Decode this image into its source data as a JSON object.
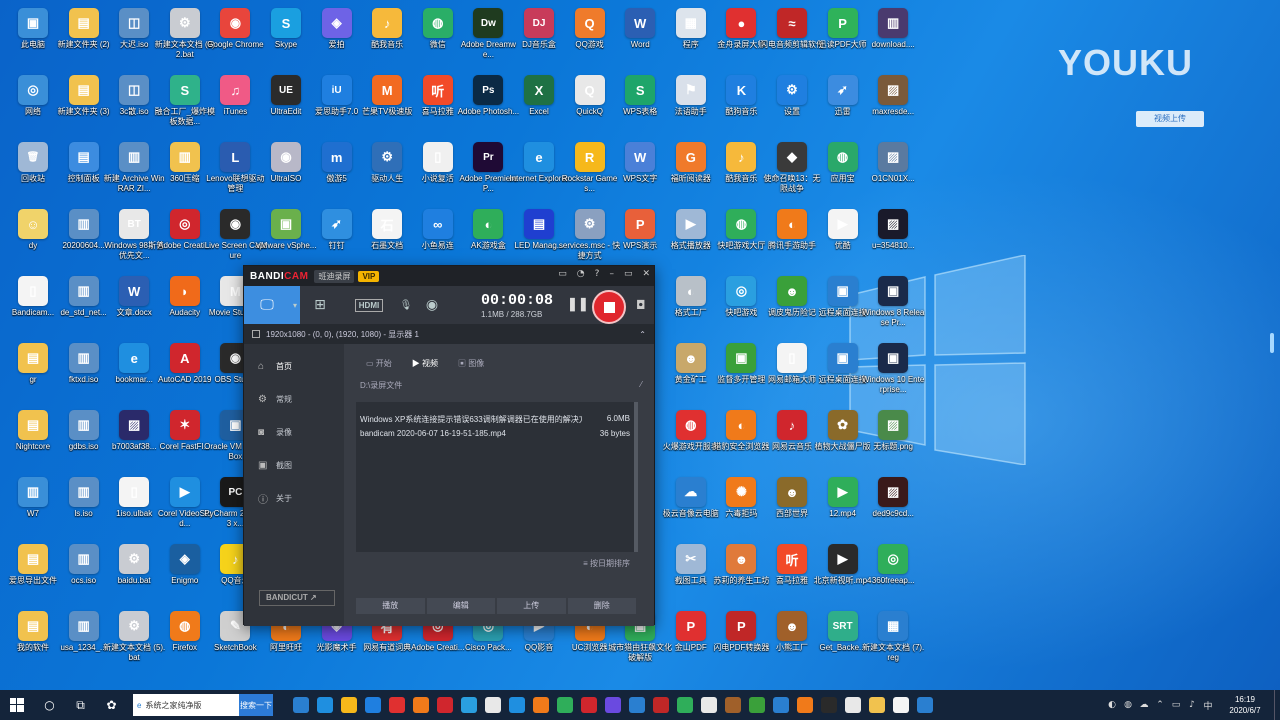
{
  "desktop": {
    "icons": [
      {
        "label": "此电脑",
        "color": "#3a8fd8",
        "glyph": "▣"
      },
      {
        "label": "新建文件夹 (2)",
        "color": "#f1c24e",
        "glyph": "▤"
      },
      {
        "label": "大迟.iso",
        "color": "#5a8fc6",
        "glyph": "◫"
      },
      {
        "label": "新建文本文档 (9)2.bat",
        "color": "#c9ccd2",
        "glyph": "⚙"
      },
      {
        "label": "Google Chrome",
        "color": "#e8453c",
        "glyph": "◉"
      },
      {
        "label": "Skype",
        "color": "#1a9fe0",
        "glyph": "S"
      },
      {
        "label": "爱拍",
        "color": "#6e63e6",
        "glyph": "◈"
      },
      {
        "label": "酷我音乐",
        "color": "#f6b93b",
        "glyph": "♪"
      },
      {
        "label": "微信",
        "color": "#2aae67",
        "glyph": "◍"
      },
      {
        "label": "Adobe Dreamwe...",
        "color": "#1f3b1f",
        "glyph": "Dw"
      },
      {
        "label": "DJ音乐盒",
        "color": "#c83b5a",
        "glyph": "DJ"
      },
      {
        "label": "QQ游戏",
        "color": "#ef7b2b",
        "glyph": "Q"
      },
      {
        "label": "Word",
        "color": "#2b5fb3",
        "glyph": "W"
      },
      {
        "label": "程序",
        "color": "#dde4ec",
        "glyph": "▦"
      },
      {
        "label": "金舟录屏大师",
        "color": "#e03030",
        "glyph": "●"
      },
      {
        "label": "闪电音频剪辑软件",
        "color": "#c02727",
        "glyph": "≈"
      },
      {
        "label": "迅读PDF大师",
        "color": "#2fb25a",
        "glyph": "P"
      },
      {
        "label": "download....",
        "color": "#4a3a6e",
        "glyph": "▥"
      },
      {
        "label": "网络",
        "color": "#3a8fd8",
        "glyph": "◎"
      },
      {
        "label": "新建文件夹 (3)",
        "color": "#f1c24e",
        "glyph": "▤"
      },
      {
        "label": "3c散.iso",
        "color": "#5a8fc6",
        "glyph": "◫"
      },
      {
        "label": "融合工厂_爆炸模板数据...",
        "color": "#2fb28a",
        "glyph": "S"
      },
      {
        "label": "iTunes",
        "color": "#f05a86",
        "glyph": "♫"
      },
      {
        "label": "UltraEdit",
        "color": "#2b2b2b",
        "glyph": "UE"
      },
      {
        "label": "爱思助手7.0",
        "color": "#1f7fe0",
        "glyph": "iU"
      },
      {
        "label": "芒果TV极速版",
        "color": "#f26a21",
        "glyph": "M"
      },
      {
        "label": "喜马拉雅",
        "color": "#f24a28",
        "glyph": "听"
      },
      {
        "label": "Adobe Photosh...",
        "color": "#0b2a45",
        "glyph": "Ps"
      },
      {
        "label": "Excel",
        "color": "#1f7144",
        "glyph": "X"
      },
      {
        "label": "QuickQ",
        "color": "#e8e8e8",
        "glyph": "Q"
      },
      {
        "label": "WPS表格",
        "color": "#1ea56a",
        "glyph": "S"
      },
      {
        "label": "法语助手",
        "color": "#d9e0ea",
        "glyph": "⚑"
      },
      {
        "label": "酷狗音乐",
        "color": "#1f7fe0",
        "glyph": "K"
      },
      {
        "label": "设置",
        "color": "#1f7fe0",
        "glyph": "⚙"
      },
      {
        "label": "迅雷",
        "color": "#3c8ce0",
        "glyph": "➶"
      },
      {
        "label": "maxresde...",
        "color": "#7a5a3a",
        "glyph": "▨"
      },
      {
        "label": "回收站",
        "color": "#9fb8d6",
        "glyph": "🗑"
      },
      {
        "label": "控制面板",
        "color": "#3c8ce0",
        "glyph": "▤"
      },
      {
        "label": "新建 Archive WinRAR ZI...",
        "color": "#5a8fc6",
        "glyph": "▥"
      },
      {
        "label": "360压缩",
        "color": "#f1c24e",
        "glyph": "▥"
      },
      {
        "label": "Lenovo联想驱动管理",
        "color": "#2a5cb0",
        "glyph": "L"
      },
      {
        "label": "UltraISO",
        "color": "#b8b8c8",
        "glyph": "◉"
      },
      {
        "label": "傲游5",
        "color": "#1f6fd0",
        "glyph": "m"
      },
      {
        "label": "驱动人生",
        "color": "#2f6fb8",
        "glyph": "⚙"
      },
      {
        "label": "小说复活",
        "color": "#f0f0f0",
        "glyph": "▯"
      },
      {
        "label": "Adobe Premiere P...",
        "color": "#1f0a35",
        "glyph": "Pr"
      },
      {
        "label": "Internet Explorer",
        "color": "#1f8fe0",
        "glyph": "e"
      },
      {
        "label": "Rockstar Games...",
        "color": "#f6b81b",
        "glyph": "R"
      },
      {
        "label": "WPS文字",
        "color": "#4a80d8",
        "glyph": "W"
      },
      {
        "label": "福昕阅读器",
        "color": "#f07a2a",
        "glyph": "G"
      },
      {
        "label": "酷我音乐",
        "color": "#f6b93b",
        "glyph": "♪"
      },
      {
        "label": "使命召唤13：无限战争",
        "color": "#3a3a3a",
        "glyph": "◆"
      },
      {
        "label": "应用宝",
        "color": "#2aa86a",
        "glyph": "◍"
      },
      {
        "label": "O1CN01X...",
        "color": "#5a7aa0",
        "glyph": "▨"
      },
      {
        "label": "dy",
        "color": "#f0d36a",
        "glyph": "☺"
      },
      {
        "label": "20200604...",
        "color": "#5a8fc6",
        "glyph": "▥"
      },
      {
        "label": "Windows 98斯普优先文...",
        "color": "#e8e8e8",
        "glyph": "BT"
      },
      {
        "label": "Adobe Creati...",
        "color": "#d0262d",
        "glyph": "◎"
      },
      {
        "label": "Live Screen Capture",
        "color": "#2a2a2a",
        "glyph": "◉"
      },
      {
        "label": "VMware vSphe...",
        "color": "#6ab04c",
        "glyph": "▣"
      },
      {
        "label": "钉钉",
        "color": "#2f8fe0",
        "glyph": "➶"
      },
      {
        "label": "石墨文档",
        "color": "#f4f4f4",
        "glyph": "石"
      },
      {
        "label": "小鱼易连",
        "color": "#1f7fe0",
        "glyph": "∞"
      },
      {
        "label": "AK游戏盒",
        "color": "#2fae5a",
        "glyph": "◐"
      },
      {
        "label": "LED Manag...",
        "color": "#1f3fd0",
        "glyph": "▤"
      },
      {
        "label": "services.msc - 快捷方式",
        "color": "#8aa0c0",
        "glyph": "⚙"
      },
      {
        "label": "WPS演示",
        "color": "#e8603a",
        "glyph": "P"
      },
      {
        "label": "格式播放器",
        "color": "#9fb8d6",
        "glyph": "▶"
      },
      {
        "label": "快吧游戏大厅",
        "color": "#2fae5a",
        "glyph": "◍"
      },
      {
        "label": "腾讯手游助手",
        "color": "#f07a1a",
        "glyph": "◐"
      },
      {
        "label": "优酷",
        "color": "#f4f4f4",
        "glyph": "▶"
      },
      {
        "label": "u=354810...",
        "color": "#1a1a2a",
        "glyph": "▨"
      },
      {
        "label": "Bandicam...",
        "color": "#f4f4f4",
        "glyph": "▯"
      },
      {
        "label": "de_std_net...",
        "color": "#5a8fc6",
        "glyph": "▥"
      },
      {
        "label": "文章.docx",
        "color": "#2b5fb3",
        "glyph": "W"
      },
      {
        "label": "Audacity",
        "color": "#f06a1a",
        "glyph": "◗"
      },
      {
        "label": "Movie Studio...",
        "color": "#e8e8e8",
        "glyph": "M"
      },
      {
        "label": "格式工厂",
        "color": "#b8c0c8",
        "glyph": "◐"
      },
      {
        "label": "快吧游戏",
        "color": "#2a9fe0",
        "glyph": "◎"
      },
      {
        "label": "调皮鬼历险记",
        "color": "#3aa03a",
        "glyph": "☻"
      },
      {
        "label": "远程桌面连接",
        "color": "#2a7fd0",
        "glyph": "▣"
      },
      {
        "label": "Windows 8 Release Pr...",
        "color": "#1a2a4a",
        "glyph": "▣"
      },
      {
        "label": "gr",
        "color": "#f1c24e",
        "glyph": "▤"
      },
      {
        "label": "fktxd.iso",
        "color": "#5a8fc6",
        "glyph": "▥"
      },
      {
        "label": "bookmar...",
        "color": "#1f8fe0",
        "glyph": "e"
      },
      {
        "label": "AutoCAD 2019",
        "color": "#d0262d",
        "glyph": "A"
      },
      {
        "label": "OBS Studio",
        "color": "#2a2a2a",
        "glyph": "◉"
      },
      {
        "label": "黄金矿工",
        "color": "#c8a86a",
        "glyph": "☻"
      },
      {
        "label": "监督多开管理",
        "color": "#3aa03a",
        "glyph": "▣"
      },
      {
        "label": "网易邮箱大师",
        "color": "#f4f4f4",
        "glyph": "▯"
      },
      {
        "label": "远程桌面连接",
        "color": "#2a7fd0",
        "glyph": "▣"
      },
      {
        "label": "Windows 10 Enterprise...",
        "color": "#1a2a4a",
        "glyph": "▣"
      },
      {
        "label": "Nightcore",
        "color": "#f1c24e",
        "glyph": "▤"
      },
      {
        "label": "gdbs.iso",
        "color": "#5a8fc6",
        "glyph": "▥"
      },
      {
        "label": "b7003af38...",
        "color": "#2a2a6a",
        "glyph": "▨"
      },
      {
        "label": "Corel FastFl...",
        "color": "#d0262d",
        "glyph": "✶"
      },
      {
        "label": "Oracle VM VirtualBox",
        "color": "#1f5fa0",
        "glyph": "▣"
      },
      {
        "label": "火爆游戏开服表",
        "color": "#e03030",
        "glyph": "◍"
      },
      {
        "label": "猎豹安全浏览器",
        "color": "#f07a1a",
        "glyph": "◐"
      },
      {
        "label": "网易云音乐",
        "color": "#d0262d",
        "glyph": "♪"
      },
      {
        "label": "植物大战僵尸版",
        "color": "#8a6a2a",
        "glyph": "✿"
      },
      {
        "label": "无标题.png",
        "color": "#4a8a4a",
        "glyph": "▨"
      },
      {
        "label": "W7",
        "color": "#3a8fd8",
        "glyph": "▥"
      },
      {
        "label": "ls.iso",
        "color": "#5a8fc6",
        "glyph": "▥"
      },
      {
        "label": "1iso.ulbak",
        "color": "#f4f4f4",
        "glyph": "▯"
      },
      {
        "label": "Corel VideoStud...",
        "color": "#1f8fe0",
        "glyph": "▶"
      },
      {
        "label": "PyCharm 2019.3.3 x...",
        "color": "#1a1a1a",
        "glyph": "PC"
      },
      {
        "label": "极云音像云电脑",
        "color": "#2a7fd0",
        "glyph": "☁"
      },
      {
        "label": "六毒拒玛",
        "color": "#f07a1a",
        "glyph": "✺"
      },
      {
        "label": "西部世界",
        "color": "#8a6a2a",
        "glyph": "☻"
      },
      {
        "label": "12.mp4",
        "color": "#2fae5a",
        "glyph": "▶"
      },
      {
        "label": "ded9c9cd...",
        "color": "#3a1a1a",
        "glyph": "▨"
      },
      {
        "label": "爱思导出文件",
        "color": "#f1c24e",
        "glyph": "▤"
      },
      {
        "label": "ocs.iso",
        "color": "#5a8fc6",
        "glyph": "▥"
      },
      {
        "label": "baidu.bat",
        "color": "#c9ccd2",
        "glyph": "⚙"
      },
      {
        "label": "Enigmo",
        "color": "#1a5fa0",
        "glyph": "◈"
      },
      {
        "label": "QQ音乐",
        "color": "#f6d31b",
        "glyph": "♪"
      },
      {
        "label": "截图工具",
        "color": "#9fb8d6",
        "glyph": "✂"
      },
      {
        "label": "苏莉的养生工坊",
        "color": "#e07a3a",
        "glyph": "☻"
      },
      {
        "label": "喜马拉雅",
        "color": "#f24a28",
        "glyph": "听"
      },
      {
        "label": "北京新视听.mp4",
        "color": "#2a2a2a",
        "glyph": "▶"
      },
      {
        "label": "360freeap...",
        "color": "#2fae5a",
        "glyph": "◎"
      },
      {
        "label": "我的软件",
        "color": "#f1c24e",
        "glyph": "▤"
      },
      {
        "label": "usa_1234_...",
        "color": "#5a8fc6",
        "glyph": "▥"
      },
      {
        "label": "新建文本文档 (5).bat",
        "color": "#c9ccd2",
        "glyph": "⚙"
      },
      {
        "label": "Firefox",
        "color": "#f07a1a",
        "glyph": "◍"
      },
      {
        "label": "SketchBook",
        "color": "#d0d0d0",
        "glyph": "✎"
      },
      {
        "label": "阿里旺旺",
        "color": "#f07a1a",
        "glyph": "◐"
      },
      {
        "label": "光影魔术手",
        "color": "#6a4ae0",
        "glyph": "◈"
      },
      {
        "label": "网易有道词典",
        "color": "#e03030",
        "glyph": "有"
      },
      {
        "label": "Adobe Creati...",
        "color": "#d0262d",
        "glyph": "◎"
      },
      {
        "label": "Cisco Pack...",
        "color": "#2a9fb0",
        "glyph": "◎"
      },
      {
        "label": "QQ影音",
        "color": "#2a7fd0",
        "glyph": "▶"
      },
      {
        "label": "UC浏览器",
        "color": "#f07a1a",
        "glyph": "◐"
      },
      {
        "label": "城市猎由狂飙文化破解版",
        "color": "#2fae5a",
        "glyph": "▣"
      },
      {
        "label": "金山PDF",
        "color": "#e03030",
        "glyph": "P"
      },
      {
        "label": "闪电PDF转换器",
        "color": "#c02727",
        "glyph": "P"
      },
      {
        "label": "小熊工厂",
        "color": "#a0602a",
        "glyph": "☻"
      },
      {
        "label": "Get_Backe...",
        "color": "#2fae8a",
        "glyph": "SRT"
      },
      {
        "label": "新建文本文档 (7).reg",
        "color": "#2a7fd0",
        "glyph": "▦"
      }
    ]
  },
  "youku": {
    "logo": "YOUKU",
    "badge": "视频上传"
  },
  "bandicam": {
    "brand_a": "BANDI",
    "brand_b": "CAM",
    "tag": "班迪录屏",
    "vip": "VIP",
    "timer": "00:00:08",
    "size": "1.1MB / 288.7GB",
    "hdmi": "HDMI",
    "sub_title": "1920x1080 - (0, 0), (1920, 1080) - 显示器 1",
    "side": [
      {
        "label": "首页",
        "icon": "⌂"
      },
      {
        "label": "常规",
        "icon": "⚙"
      },
      {
        "label": "录像",
        "icon": "◙"
      },
      {
        "label": "截图",
        "icon": "▣"
      },
      {
        "label": "关于",
        "icon": "ⓘ"
      }
    ],
    "bandicut": "BANDICUT ↗",
    "tabs": [
      {
        "label": "开始",
        "icon": "▭"
      },
      {
        "label": "视频",
        "icon": "▶"
      },
      {
        "label": "图像",
        "icon": "▣"
      }
    ],
    "path": "D:\\录屏文件",
    "files": [
      {
        "name": "Windows XP系统连接提示错误633调制解调器已在使用的解决方法.mp4",
        "size": "6.0MB"
      },
      {
        "name": "bandicam 2020-06-07 16-19-51-185.mp4",
        "size": "36 bytes"
      }
    ],
    "sort": "按日期排序",
    "actions": [
      "播放",
      "编辑",
      "上传",
      "删除"
    ]
  },
  "taskbar": {
    "search_placeholder": "系统之家纯净版",
    "search_button": "搜索一下",
    "time": "16:19",
    "date": "2020/6/7",
    "app_colors": [
      "#2a7fd0",
      "#1f8fe0",
      "#f6b81b",
      "#1f7fe0",
      "#e03030",
      "#f07a1a",
      "#d0262d",
      "#2a9fe0",
      "#e8e8e8",
      "#1f8fe0",
      "#f07a1a",
      "#2fae5a",
      "#d0262d",
      "#6a4ae0",
      "#2a7fd0",
      "#c02727",
      "#2fae5a",
      "#e8e8e8",
      "#a0602a",
      "#3aa03a",
      "#2a7fd0",
      "#f07a1a",
      "#2a2a2a",
      "#e8e8e8",
      "#f1c24e",
      "#f4f4f4",
      "#2a7fd0"
    ]
  }
}
